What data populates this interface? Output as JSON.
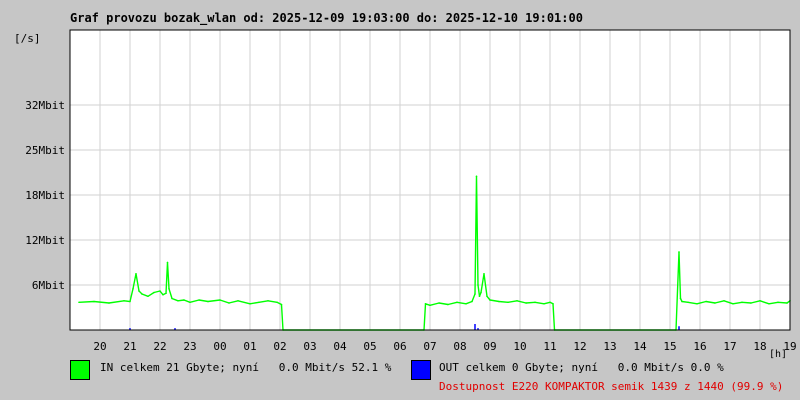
{
  "title": "Graf provozu bozak_wlan od: 2025-12-09 19:03:00 do: 2025-12-10 19:01:00",
  "colors": {
    "background": "#c6c6c6",
    "plot_background": "#ffffff",
    "grid": "#d2d2d2",
    "in_series": "#00ff00",
    "out_series": "#0000ff",
    "availability_text": "#e00000"
  },
  "legend": {
    "in_text": "IN celkem 21 Gbyte; nyní   0.0 Mbit/s 52.1 %",
    "out_text": "OUT celkem 0 Gbyte; nyní   0.0 Mbit/s 0.0 %",
    "availability": "Dostupnost E220 KOMPAKTOR semik 1439 z 1440 (99.9 %)"
  },
  "chart_data": {
    "type": "area",
    "ylabel": "[/s]",
    "xlabel": "[h]",
    "ylim": [
      0,
      40
    ],
    "ytick_values": [
      6,
      12,
      18,
      24,
      30
    ],
    "ytick_labels": [
      "6Mbit",
      "12Mbit",
      "18Mbit",
      "25Mbit",
      "32Mbit"
    ],
    "xtick_labels": [
      "20",
      "21",
      "22",
      "23",
      "00",
      "01",
      "02",
      "03",
      "04",
      "05",
      "06",
      "07",
      "08",
      "09",
      "10",
      "11",
      "12",
      "13",
      "14",
      "15",
      "16",
      "17",
      "18",
      "19"
    ],
    "grid": true,
    "series": [
      {
        "name": "IN",
        "color": "#00ff00",
        "x": [
          19.3,
          19.8,
          20.3,
          20.8,
          21.0,
          21.1,
          21.2,
          21.3,
          21.4,
          21.6,
          21.8,
          22.0,
          22.1,
          22.2,
          22.25,
          22.3,
          22.4,
          22.6,
          22.8,
          23.0,
          23.3,
          23.6,
          24.0,
          24.3,
          24.6,
          25.0,
          25.3,
          25.6,
          25.9,
          26.05,
          26.1,
          30.8,
          30.85,
          31.0,
          31.3,
          31.6,
          31.9,
          32.2,
          32.4,
          32.5,
          32.55,
          32.6,
          32.65,
          32.7,
          32.8,
          32.9,
          33.0,
          33.3,
          33.6,
          33.9,
          34.2,
          34.5,
          34.8,
          35.0,
          35.1,
          35.15,
          39.2,
          39.3,
          39.35,
          39.4,
          39.6,
          39.9,
          40.2,
          40.5,
          40.8,
          41.1,
          41.4,
          41.7,
          42.0,
          42.3,
          42.6,
          42.9,
          43.0
        ],
        "y": [
          3.7,
          3.8,
          3.6,
          3.9,
          3.8,
          5.5,
          7.5,
          5.2,
          4.8,
          4.5,
          5.0,
          5.2,
          4.7,
          4.9,
          9.0,
          5.5,
          4.2,
          3.9,
          4.0,
          3.7,
          4.0,
          3.8,
          4.0,
          3.6,
          3.9,
          3.5,
          3.7,
          3.9,
          3.7,
          3.4,
          0,
          0,
          3.5,
          3.3,
          3.6,
          3.4,
          3.7,
          3.5,
          3.8,
          4.8,
          20.5,
          6.0,
          4.5,
          5.0,
          7.5,
          4.5,
          4.0,
          3.8,
          3.7,
          3.9,
          3.6,
          3.7,
          3.5,
          3.7,
          3.5,
          0,
          0,
          10.4,
          4.2,
          3.8,
          3.7,
          3.5,
          3.8,
          3.6,
          3.9,
          3.5,
          3.7,
          3.6,
          3.9,
          3.5,
          3.7,
          3.6,
          3.9
        ]
      },
      {
        "name": "OUT",
        "color": "#0000ff",
        "x": [
          21.0,
          22.5,
          32.5,
          32.6,
          39.3
        ],
        "y": [
          0.25,
          0.25,
          0.8,
          0.25,
          0.5
        ]
      }
    ]
  }
}
